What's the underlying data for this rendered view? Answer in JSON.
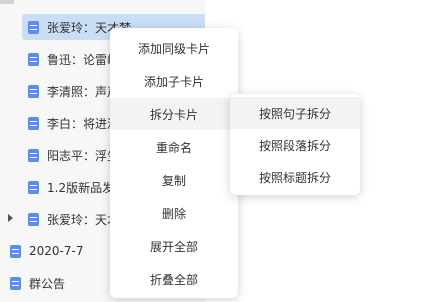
{
  "tree": {
    "items": [
      {
        "label": "张爱玲：天才梦",
        "selected": true
      },
      {
        "label": "鲁迅：论雷峰塔的倒掉"
      },
      {
        "label": "李清照：声声慢"
      },
      {
        "label": "李白：将进酒"
      },
      {
        "label": "阳志平：浮生"
      },
      {
        "label": "1.2版新品发布"
      },
      {
        "label": "张爱玲：天才梦"
      },
      {
        "label": "2020-7-7"
      },
      {
        "label": "群公告"
      }
    ]
  },
  "context_menu": {
    "items": [
      {
        "label": "添加同级卡片"
      },
      {
        "label": "添加子卡片"
      },
      {
        "label": "拆分卡片",
        "hovered": true
      },
      {
        "label": "重命名"
      },
      {
        "label": "复制"
      },
      {
        "label": "删除"
      },
      {
        "label": "展开全部"
      },
      {
        "label": "折叠全部"
      }
    ]
  },
  "submenu": {
    "items": [
      {
        "label": "按照句子拆分",
        "hovered": true
      },
      {
        "label": "按照段落拆分"
      },
      {
        "label": "按照标题拆分"
      }
    ]
  },
  "colors": {
    "accent": "#5b8def",
    "selected_row": "#c9def5",
    "tree_bg": "#f7f7f8",
    "menu_hover": "#f2f3f5"
  }
}
